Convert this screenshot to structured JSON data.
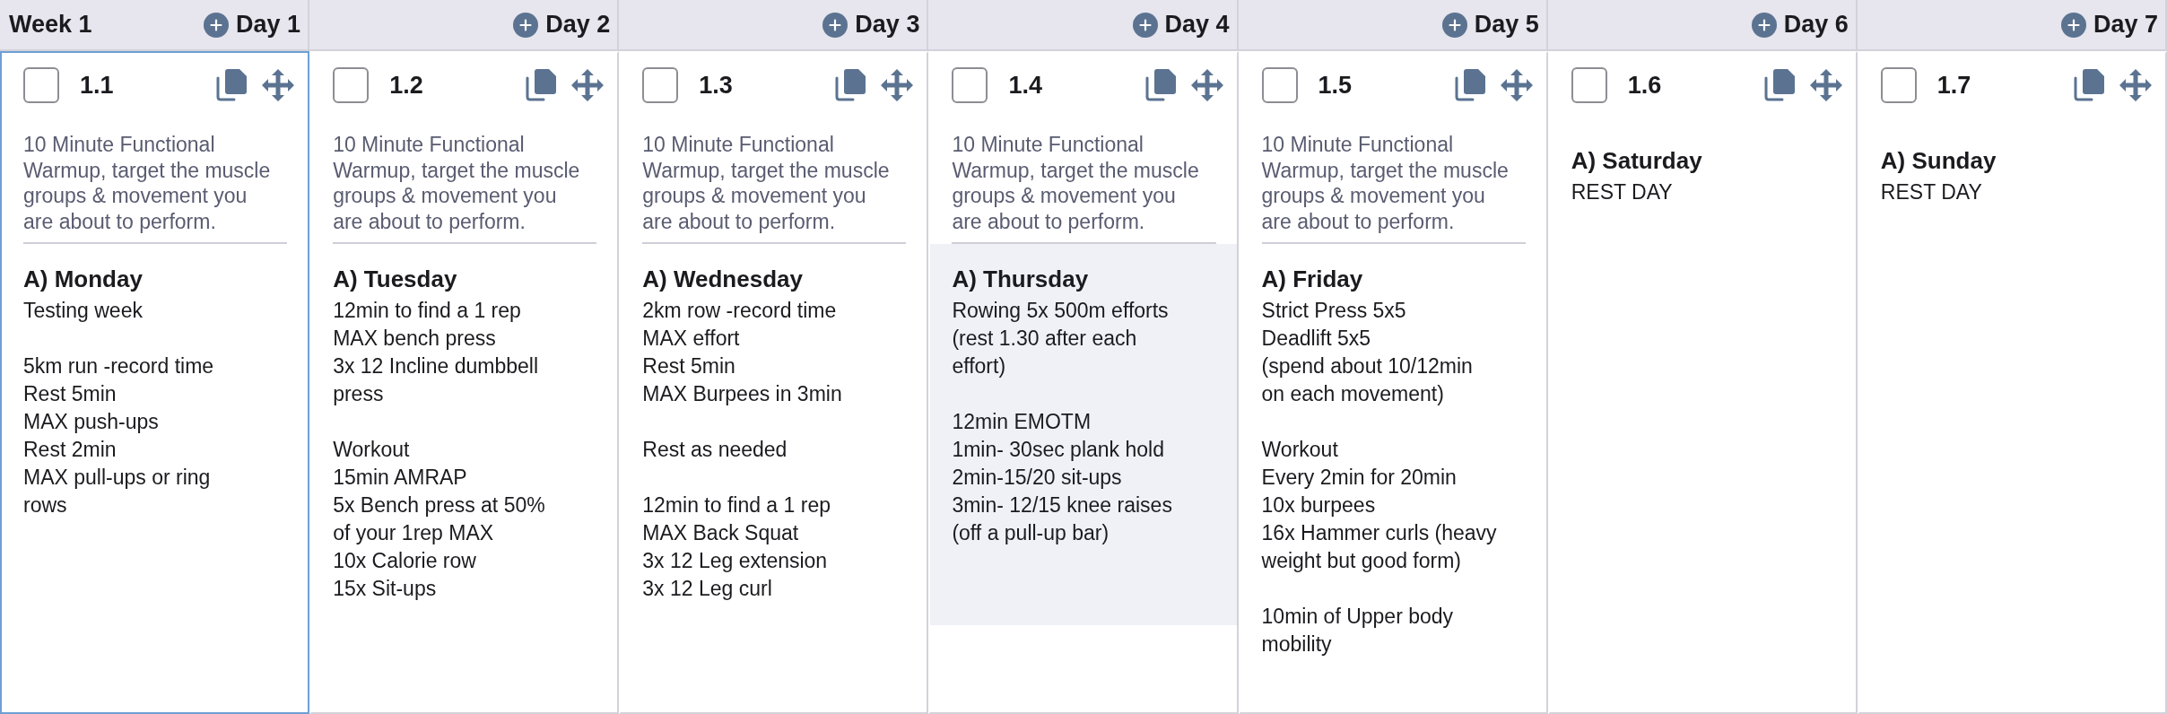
{
  "week_label": "Week 1",
  "days": [
    {
      "label": "Day 1",
      "selected": true,
      "number": "1.1",
      "checked": false,
      "warmup": "10 Minute Functional\nWarmup, target the muscle\ngroups & movement you\nare about to perform.",
      "workout": {
        "title": "A) Monday",
        "details": "Testing week\n\n5km run -record time\nRest 5min\nMAX push-ups\nRest 2min\nMAX pull-ups or ring\nrows",
        "highlighted": false
      }
    },
    {
      "label": "Day 2",
      "selected": false,
      "number": "1.2",
      "checked": false,
      "warmup": "10 Minute Functional\nWarmup, target the muscle\ngroups & movement you\nare about to perform.",
      "workout": {
        "title": "A) Tuesday",
        "details": "12min to find a 1 rep\nMAX bench press\n3x 12 Incline dumbbell\npress\n\nWorkout\n15min AMRAP\n5x Bench press at 50%\nof your 1rep MAX\n10x Calorie row\n15x Sit-ups",
        "highlighted": false
      }
    },
    {
      "label": "Day 3",
      "selected": false,
      "number": "1.3",
      "checked": false,
      "warmup": "10 Minute Functional\nWarmup, target the muscle\ngroups & movement you\nare about to perform.",
      "workout": {
        "title": "A) Wednesday",
        "details": "2km row -record time\nMAX effort\nRest 5min\nMAX Burpees in 3min\n\nRest as needed\n\n12min to find a 1 rep\nMAX Back Squat\n3x 12 Leg extension\n3x 12 Leg curl",
        "highlighted": false
      }
    },
    {
      "label": "Day 4",
      "selected": false,
      "number": "1.4",
      "checked": false,
      "warmup": "10 Minute Functional\nWarmup, target the muscle\ngroups & movement you\nare about to perform.",
      "workout": {
        "title": "A) Thursday",
        "details": "Rowing 5x 500m efforts\n(rest 1.30 after each\neffort)\n\n12min EMOTM\n1min- 30sec plank hold\n2min-15/20 sit-ups\n3min- 12/15 knee raises\n(off a pull-up bar)",
        "highlighted": true
      }
    },
    {
      "label": "Day 5",
      "selected": false,
      "number": "1.5",
      "checked": false,
      "warmup": "10 Minute Functional\nWarmup, target the muscle\ngroups & movement you\nare about to perform.",
      "workout": {
        "title": "A) Friday",
        "details": "Strict Press 5x5\nDeadlift 5x5\n(spend about 10/12min\non each movement)\n\nWorkout\nEvery 2min for 20min\n10x burpees\n16x Hammer curls (heavy\nweight but good form)\n\n10min of Upper body\nmobility",
        "highlighted": false
      }
    },
    {
      "label": "Day 6",
      "selected": false,
      "number": "1.6",
      "checked": false,
      "workout": {
        "title": "A) Saturday",
        "details": "REST DAY",
        "highlighted": false
      }
    },
    {
      "label": "Day 7",
      "selected": false,
      "number": "1.7",
      "checked": false,
      "workout": {
        "title": "A) Sunday",
        "details": "REST DAY",
        "highlighted": false
      }
    }
  ]
}
